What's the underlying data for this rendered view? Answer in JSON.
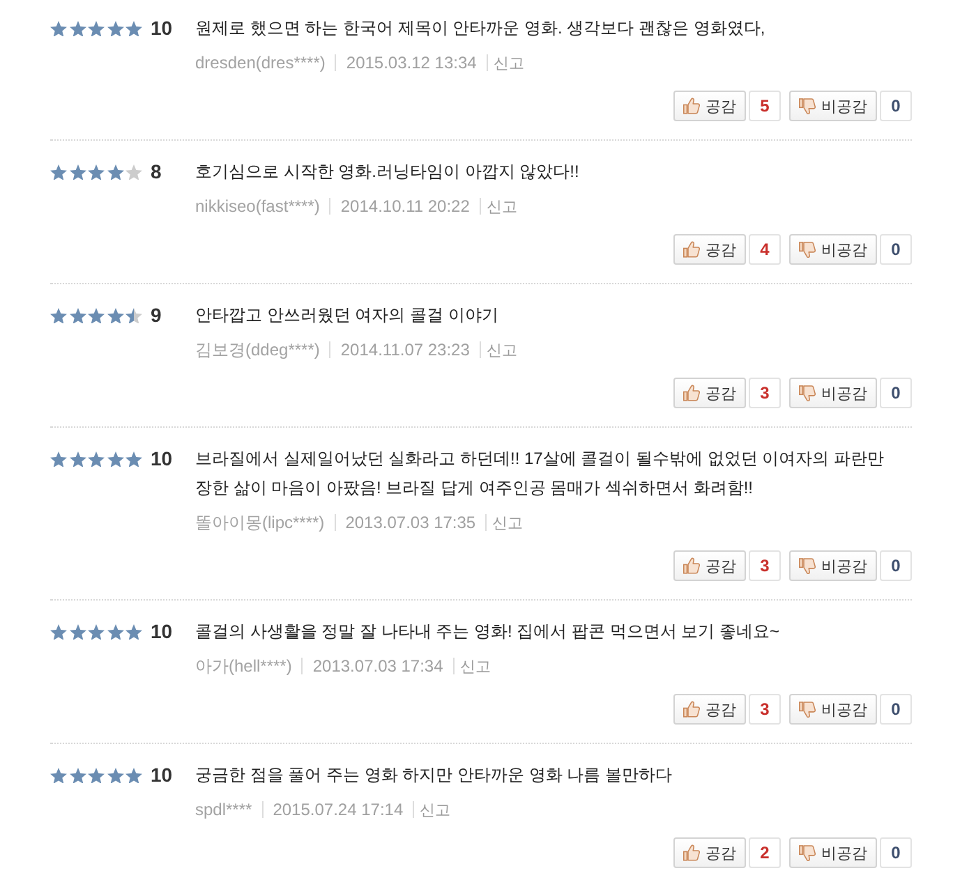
{
  "reviews": [
    {
      "stars": 5,
      "score": "10",
      "text": "원제로 했으면 하는 한국어 제목이 안타까운 영화. 생각보다 괜찮은 영화였다,",
      "author": "dresden(dres****)",
      "date": "2015.03.12 13:34",
      "report": "신고",
      "like": {
        "label": "공감",
        "count": "5"
      },
      "dislike": {
        "label": "비공감",
        "count": "0"
      }
    },
    {
      "stars": 4,
      "score": "8",
      "text": "호기심으로 시작한 영화.러닝타임이 아깝지 않았다!!",
      "author": "nikkiseo(fast****)",
      "date": "2014.10.11 20:22",
      "report": "신고",
      "like": {
        "label": "공감",
        "count": "4"
      },
      "dislike": {
        "label": "비공감",
        "count": "0"
      }
    },
    {
      "stars": 4.5,
      "score": "9",
      "text": "안타깝고 안쓰러웠던 여자의 콜걸 이야기",
      "author": "김보경(ddeg****)",
      "date": "2014.11.07 23:23",
      "report": "신고",
      "like": {
        "label": "공감",
        "count": "3"
      },
      "dislike": {
        "label": "비공감",
        "count": "0"
      }
    },
    {
      "stars": 5,
      "score": "10",
      "text": "브라질에서 실제일어났던 실화라고 하던데!! 17살에 콜걸이 될수밖에 없었던 이여자의 파란만장한 삶이 마음이 아팠음! 브라질 답게 여주인공 몸매가 섹쉬하면서 화려함!!",
      "author": "똘아이몽(lipc****)",
      "date": "2013.07.03 17:35",
      "report": "신고",
      "like": {
        "label": "공감",
        "count": "3"
      },
      "dislike": {
        "label": "비공감",
        "count": "0"
      }
    },
    {
      "stars": 5,
      "score": "10",
      "text": "콜걸의 사생활을 정말 잘 나타내 주는 영화! 집에서 팝콘 먹으면서 보기 좋네요~",
      "author": "아가(hell****)",
      "date": "2013.07.03 17:34",
      "report": "신고",
      "like": {
        "label": "공감",
        "count": "3"
      },
      "dislike": {
        "label": "비공감",
        "count": "0"
      }
    },
    {
      "stars": 5,
      "score": "10",
      "text": "궁금한 점을 풀어 주는 영화 하지만 안타까운 영화 나름 볼만하다",
      "author": "spdl****",
      "date": "2015.07.24 17:14",
      "report": "신고",
      "like": {
        "label": "공감",
        "count": "2"
      },
      "dislike": {
        "label": "비공감",
        "count": "0"
      }
    }
  ]
}
